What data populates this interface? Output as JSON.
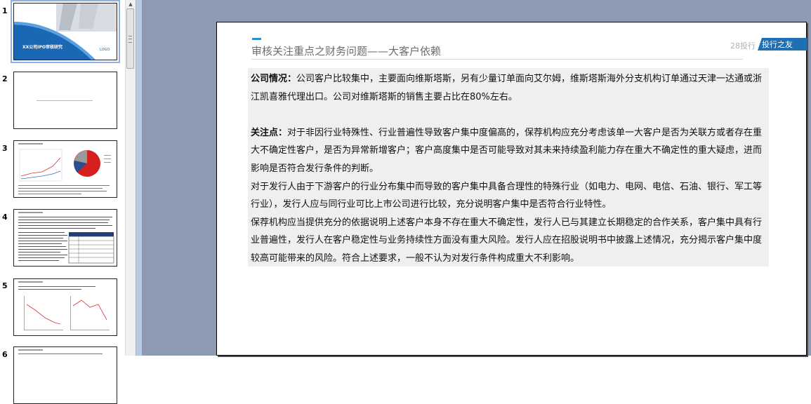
{
  "thumbnails": [
    {
      "num": "1",
      "title": "XX公司IPO审核研究",
      "logo": "LOGO"
    },
    {
      "num": "2"
    },
    {
      "num": "3"
    },
    {
      "num": "4"
    },
    {
      "num": "5"
    },
    {
      "num": "6"
    }
  ],
  "slide": {
    "title": "审核关注重点之财务问题——大客户依赖",
    "brand_num": "28投行",
    "brand_tag": "投行之友",
    "company_label": "公司情况：",
    "company_text": "公司客户比较集中，主要面向维斯塔斯，另有少量订单面向艾尔姆，维斯塔斯海外分支机构订单通过天津一达通或浙江凯喜雅代理出口。公司对维斯塔斯的销售主要占比在80%左右。",
    "focus_label": "关注点：",
    "focus_text": "对于非因行业特殊性、行业普遍性导致客户集中度偏高的，保荐机构应充分考虑该单一大客户是否为关联方或者存在重大不确定性客户，是否为异常新增客户；客户高度集中是否可能导致对其未来持续盈利能力存在重大不确定性的重大疑虑，进而影响是否符合发行条件的判断。",
    "para2": "对于发行人由于下游客户的行业分布集中而导致的客户集中具备合理性的特殊行业（如电力、电网、电信、石油、银行、军工等行业），发行人应与同行业可比上市公司进行比较，充分说明客户集中是否符合行业特性。",
    "para3": "保荐机构应当提供充分的依据说明上述客户本身不存在重大不确定性，发行人已与其建立长期稳定的合作关系，客户集中具有行业普遍性，发行人在客户稳定性与业务持续性方面没有重大风险。发行人应在招股说明书中披露上述情况，充分揭示客户集中度较高可能带来的风险。符合上述要求，一般不认为对发行条件构成重大不利影响。"
  },
  "colors": {
    "workspace": "#8e99b2",
    "accent": "#1f6fb5",
    "content_bg": "#efefef"
  }
}
